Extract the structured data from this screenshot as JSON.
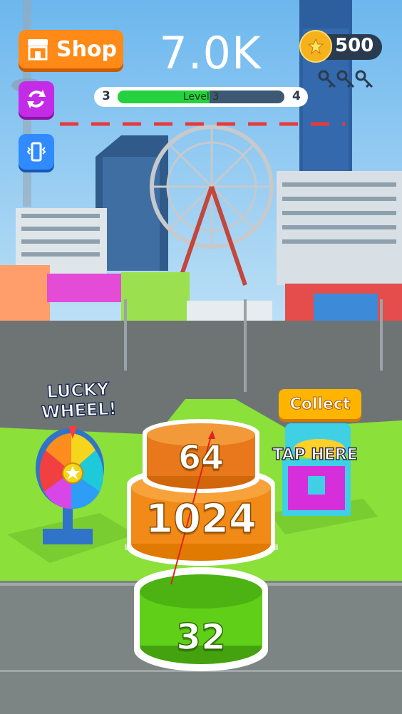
{
  "hud": {
    "shop_label": "Shop",
    "score": "7.0K",
    "coins": "500",
    "level_current": "3",
    "level_next": "4",
    "level_label": "Level 3",
    "level_progress": 0.55,
    "keys_count": 3
  },
  "world": {
    "lucky_wheel_line1": "LUCKY",
    "lucky_wheel_line2": "WHEEL!",
    "collect_label": "Collect",
    "tap_here_label": "TAP HERE"
  },
  "tower": {
    "top_block_value": "64",
    "middle_block_value": "1024",
    "shooter_block_value": "32"
  },
  "colors": {
    "sky": "#7fc4ef",
    "ground_green": "#8be03a",
    "road": "#7d8484",
    "orange_block": "#f28a17",
    "green_block": "#5fcf18",
    "danger_line": "#e43b3b"
  }
}
